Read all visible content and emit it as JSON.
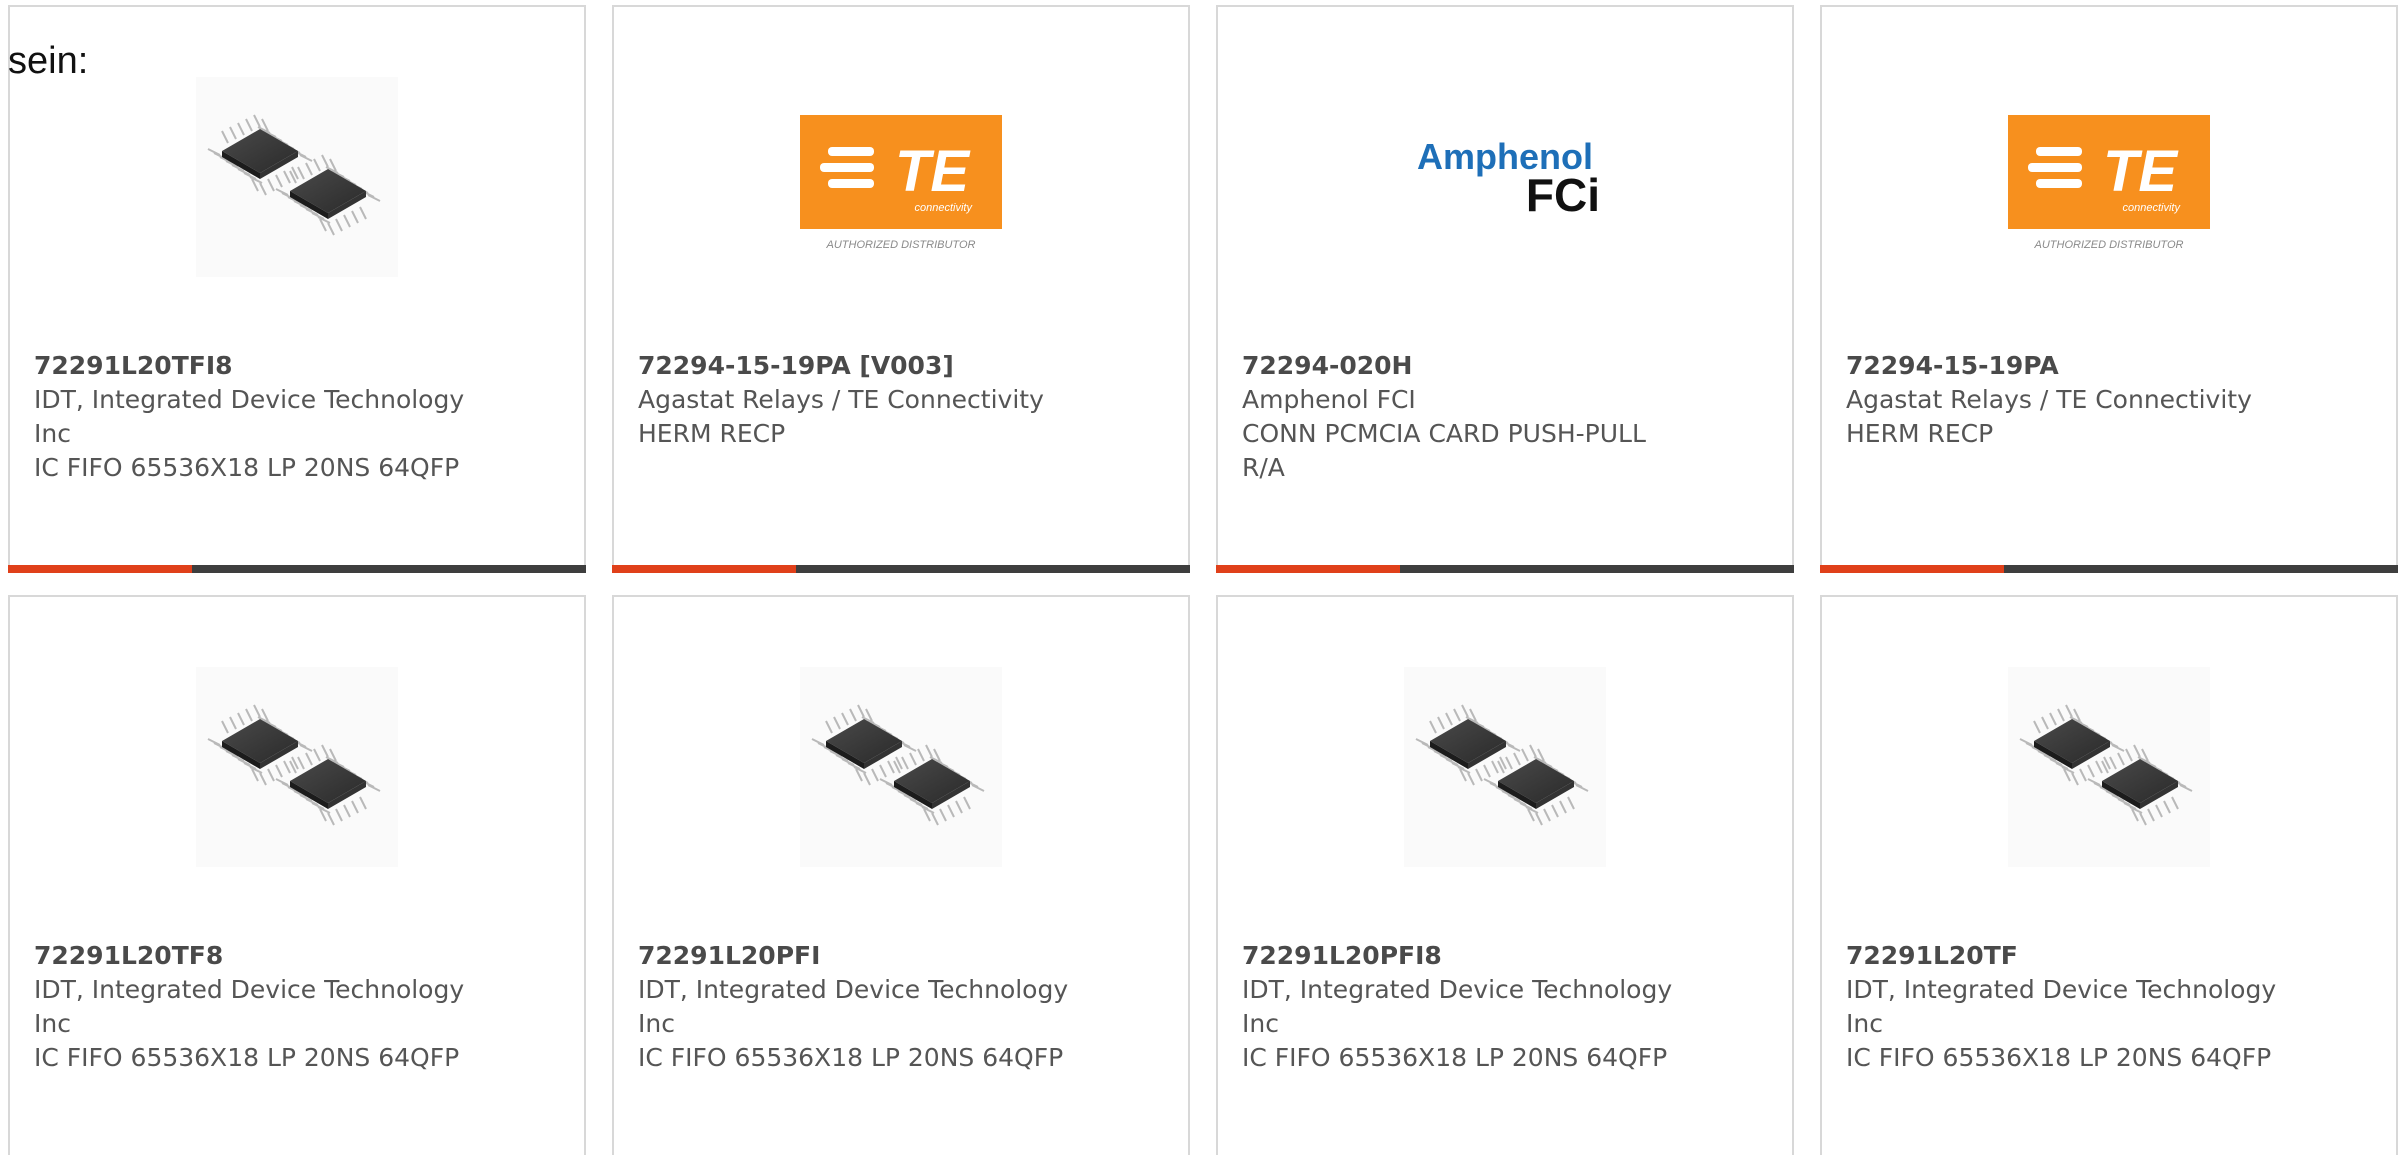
{
  "intro_text": "sein:",
  "colors": {
    "accent": "#e0401a",
    "bar": "#3e3e3e",
    "te_orange": "#f7901e",
    "amphenol_blue": "#1e6fb8"
  },
  "logos": {
    "te_main": "TE",
    "te_sub": "connectivity",
    "te_caption": "AUTHORIZED DISTRIBUTOR",
    "amphenol_top": "Amphenol",
    "amphenol_bottom": "FCi"
  },
  "products": [
    {
      "part_no": "72291L20TFI8",
      "maker": "IDT, Integrated Device Technology Inc",
      "desc": "IC FIFO 65536X18 LP 20NS 64QFP",
      "image": "ic-chip-image"
    },
    {
      "part_no": "72294-15-19PA [V003]",
      "maker": "Agastat Relays / TE Connectivity",
      "desc": "HERM RECP",
      "image": "te-connectivity-logo"
    },
    {
      "part_no": "72294-020H",
      "maker": "Amphenol FCI",
      "desc": "CONN PCMCIA CARD PUSH-PULL R/A",
      "image": "amphenol-fci-logo"
    },
    {
      "part_no": "72294-15-19PA",
      "maker": "Agastat Relays / TE Connectivity",
      "desc": "HERM RECP",
      "image": "te-connectivity-logo"
    },
    {
      "part_no": "72291L20TF8",
      "maker": "IDT, Integrated Device Technology Inc",
      "desc": "IC FIFO 65536X18 LP 20NS 64QFP",
      "image": "ic-chip-image"
    },
    {
      "part_no": "72291L20PFI",
      "maker": "IDT, Integrated Device Technology Inc",
      "desc": "IC FIFO 65536X18 LP 20NS 64QFP",
      "image": "ic-chip-image"
    },
    {
      "part_no": "72291L20PFI8",
      "maker": "IDT, Integrated Device Technology Inc",
      "desc": "IC FIFO 65536X18 LP 20NS 64QFP",
      "image": "ic-chip-image"
    },
    {
      "part_no": "72291L20TF",
      "maker": "IDT, Integrated Device Technology Inc",
      "desc": "IC FIFO 65536X18 LP 20NS 64QFP",
      "image": "ic-chip-image"
    }
  ]
}
